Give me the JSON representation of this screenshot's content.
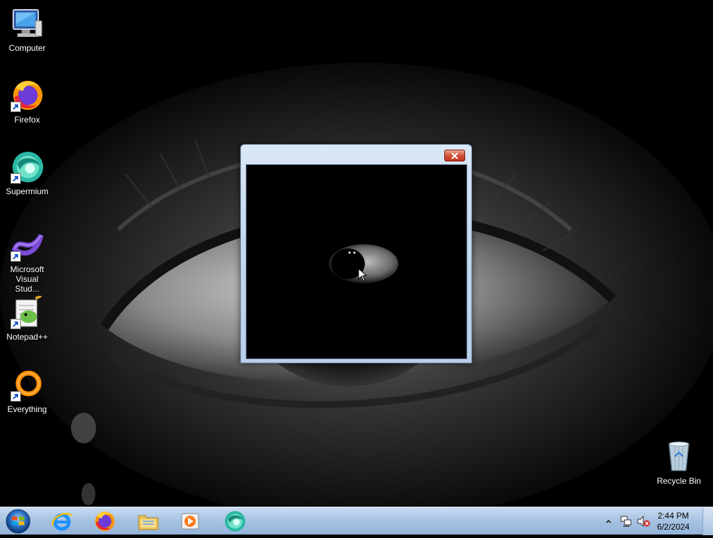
{
  "desktop": {
    "icons": [
      {
        "label": "Computer",
        "icon": "computer-icon"
      },
      {
        "label": "Firefox",
        "icon": "firefox-icon"
      },
      {
        "label": "Supermium",
        "icon": "supermium-icon"
      },
      {
        "label": "Microsoft Visual Stud...",
        "icon": "visual-studio-icon"
      },
      {
        "label": "Notepad++",
        "icon": "notepadpp-icon"
      },
      {
        "label": "Everything",
        "icon": "everything-icon"
      },
      {
        "label": "Recycle Bin",
        "icon": "recycle-bin-icon"
      }
    ]
  },
  "window": {
    "title": "",
    "close_icon": "close-icon"
  },
  "taskbar": {
    "start_icon": "windows-start-icon",
    "pinned": [
      "internet-explorer-icon",
      "firefox-icon",
      "file-explorer-icon",
      "media-player-icon",
      "supermium-icon"
    ],
    "tray_icons": [
      "show-hidden-icons-chevron",
      "network-icon",
      "volume-muted-icon"
    ],
    "clock": {
      "time": "2:44 PM",
      "date": "6/2/2024"
    }
  },
  "colors": {
    "taskbar": "#a9c4e3",
    "close_button": "#c2331b",
    "window_frame": "#c6d9ee"
  }
}
